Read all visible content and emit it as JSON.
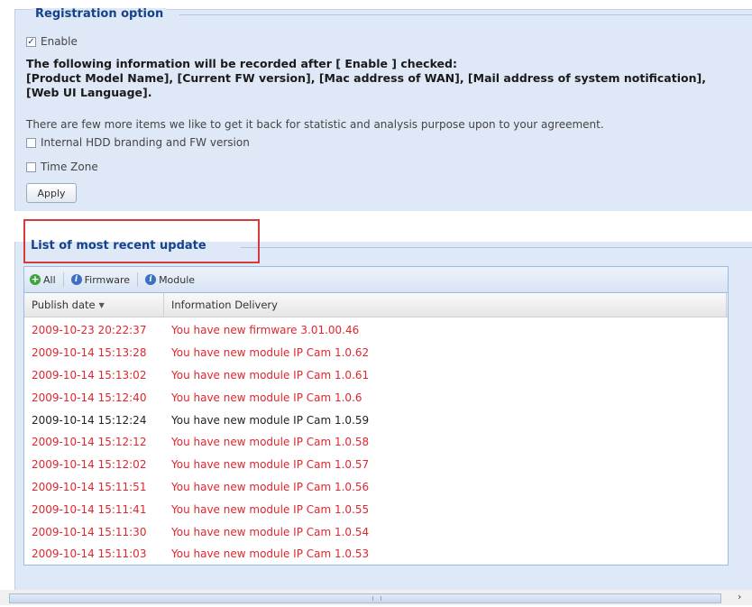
{
  "registration": {
    "legend": "Registration option",
    "enable_label": "Enable",
    "enable_checked": true,
    "info_heading": "The following information will be recorded after [ Enable ] checked:",
    "info_items_line1": "[Product Model Name], [Current FW version], [Mac address of WAN], [Mail address of system notification],",
    "info_items_line2": "[Web UI Language].",
    "extra_text": "There are few more items we like to get it back for statistic and analysis purpose upon to your agreement.",
    "hdd_label": "Internal HDD branding and FW version",
    "hdd_checked": false,
    "timezone_label": "Time Zone",
    "timezone_checked": false,
    "apply_label": "Apply"
  },
  "updates": {
    "legend": "List of most recent update",
    "toolbar": {
      "all_label": "All",
      "firmware_label": "Firmware",
      "module_label": "Module"
    },
    "columns": {
      "publish_date": "Publish date",
      "information": "Information Delivery"
    },
    "rows": [
      {
        "date": "2009-10-23 20:22:37",
        "info": "You have new firmware 3.01.00.46",
        "color": "#e0262e"
      },
      {
        "date": "2009-10-14 15:13:28",
        "info": "You have new module IP Cam 1.0.62",
        "color": "#e0262e"
      },
      {
        "date": "2009-10-14 15:13:02",
        "info": "You have new module IP Cam 1.0.61",
        "color": "#e0262e"
      },
      {
        "date": "2009-10-14 15:12:40",
        "info": "You have new module IP Cam 1.0.6",
        "color": "#e0262e"
      },
      {
        "date": "2009-10-14 15:12:24",
        "info": "You have new module IP Cam 1.0.59",
        "color": "#222222"
      },
      {
        "date": "2009-10-14 15:12:12",
        "info": "You have new module IP Cam 1.0.58",
        "color": "#e0262e"
      },
      {
        "date": "2009-10-14 15:12:02",
        "info": "You have new module IP Cam 1.0.57",
        "color": "#e0262e"
      },
      {
        "date": "2009-10-14 15:11:51",
        "info": "You have new module IP Cam 1.0.56",
        "color": "#e0262e"
      },
      {
        "date": "2009-10-14 15:11:41",
        "info": "You have new module IP Cam 1.0.55",
        "color": "#e0262e"
      },
      {
        "date": "2009-10-14 15:11:30",
        "info": "You have new module IP Cam 1.0.54",
        "color": "#e0262e"
      },
      {
        "date": "2009-10-14 15:11:03",
        "info": "You have new module IP Cam 1.0.53",
        "color": "#e0262e"
      }
    ]
  },
  "colors": {
    "unread": "#e0262e",
    "read": "#222222",
    "highlight_box": "#d63a3a",
    "panel_bg": "#dfe8f6"
  }
}
